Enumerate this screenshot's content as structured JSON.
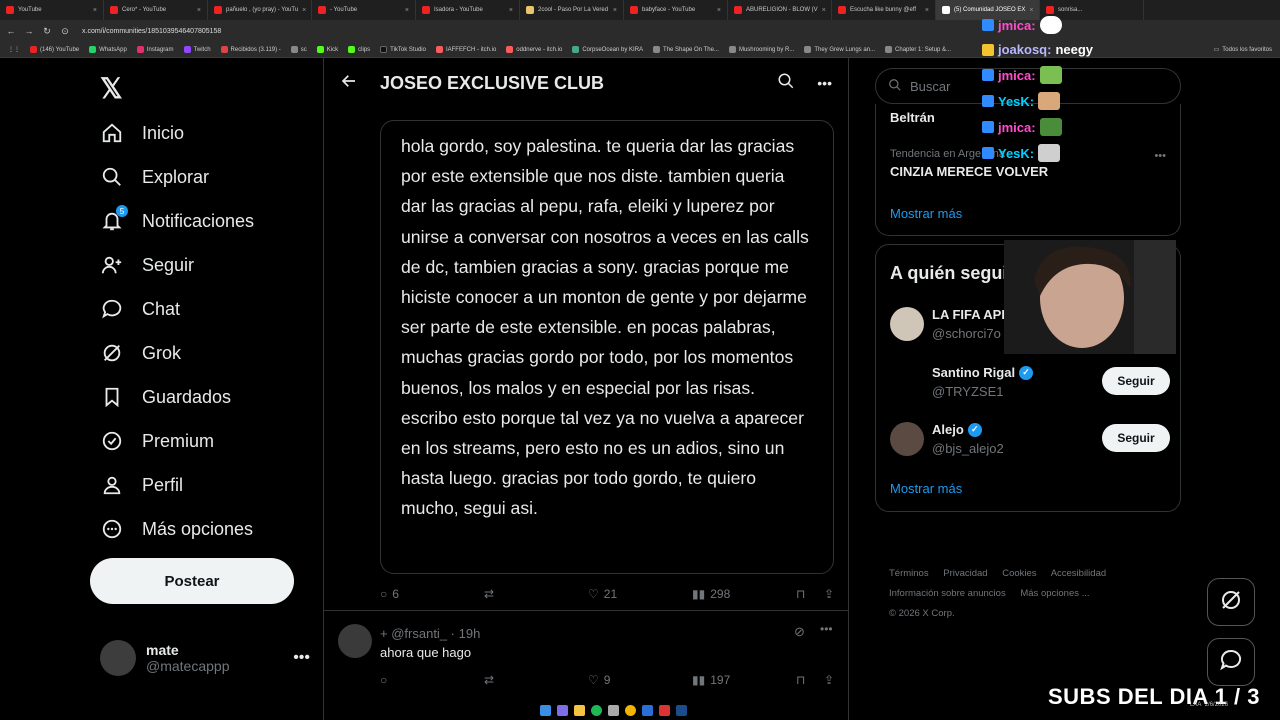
{
  "browser": {
    "tabs": [
      {
        "label": "YouTube",
        "active": false
      },
      {
        "label": "Cero* - YouTube",
        "active": false
      },
      {
        "label": "pañuelo , (yo pray) - YouTu",
        "active": false
      },
      {
        "label": "- YouTube",
        "active": false
      },
      {
        "label": "Isadora - YouTube",
        "active": false
      },
      {
        "label": "2cool - Paso Por La Vered",
        "active": false
      },
      {
        "label": "babyface - YouTube",
        "active": false
      },
      {
        "label": "ABURELIGION - BLOW (V",
        "active": false
      },
      {
        "label": "Escucha like bunny @eff",
        "active": false
      },
      {
        "label": "(5) Comunidad JOSEO EX",
        "active": true
      },
      {
        "label": "sonrisa...",
        "active": false
      }
    ],
    "url": "x.com/i/communities/1851039546407805158",
    "bookmarks": [
      "(146) YouTube",
      "WhatsApp",
      "Instagram",
      "Twitch",
      "Recibidos (3.119) -",
      "sc",
      "Kick",
      "clips",
      "TikTok Studio",
      "IAFFEFCH - itch.io",
      "oddnerve - itch.io",
      "CorpseOcean by KIRA",
      "The Shape On The...",
      "Mushrooming by R...",
      "They Grew Lungs an...",
      "Chapter 1: Setup &..."
    ],
    "bookmarks_right": "Todos los favoritos"
  },
  "nav": {
    "items": [
      {
        "label": "Inicio",
        "icon": "home-icon"
      },
      {
        "label": "Explorar",
        "icon": "search-icon"
      },
      {
        "label": "Notificaciones",
        "icon": "bell-icon",
        "badge": "5"
      },
      {
        "label": "Seguir",
        "icon": "add-person-icon"
      },
      {
        "label": "Chat",
        "icon": "chat-icon"
      },
      {
        "label": "Grok",
        "icon": "grok-icon"
      },
      {
        "label": "Guardados",
        "icon": "bookmark-icon"
      },
      {
        "label": "Premium",
        "icon": "premium-icon"
      },
      {
        "label": "Perfil",
        "icon": "person-icon"
      },
      {
        "label": "Más opciones",
        "icon": "more-circle-icon"
      }
    ],
    "post_label": "Postear",
    "account": {
      "name": "mate",
      "handle": "@matecappp"
    }
  },
  "main": {
    "title": "JOSEO EXCLUSIVE CLUB",
    "message": "hola gordo, soy palestina. te queria dar las gracias por este extensible que nos diste. tambien queria dar las gracias al pepu, rafa, eleiki y luperez por unirse a conversar con nosotros a veces en las calls de dc, tambien gracias a sony. gracias porque me hiciste conocer a un monton de gente y por dejarme ser parte de este extensible. en pocas palabras, muchas gracias gordo por todo, por los momentos buenos, los malos y en especial por las risas. escribo esto porque tal vez ya no vuelva a aparecer en los streams, pero esto no es un adios, sino un hasta luego. gracias por todo gordo, te quiero mucho, segui asi.",
    "post_stats": {
      "replies": "6",
      "likes": "21",
      "views": "298"
    },
    "reply": {
      "handle": "@frsanti_",
      "time": "19h",
      "text": "ahora que hago",
      "likes": "9",
      "views": "197"
    }
  },
  "right": {
    "search_placeholder": "Buscar",
    "trends": [
      {
        "context": "",
        "name": "Beltrán"
      },
      {
        "context": "Tendencia en Argentina",
        "name": "CINZIA MERECE VOLVER"
      }
    ],
    "trends_more": "Mostrar más",
    "follow_title": "A quién seguir",
    "suggestions": [
      {
        "name": "LA FIFA APRETO",
        "handle": "@schorci7o",
        "verified": false
      },
      {
        "name": "Santino Rigal",
        "handle": "@TRYZSE1",
        "verified": true
      },
      {
        "name": "Alejo",
        "handle": "@bjs_alejo2",
        "verified": true
      }
    ],
    "follow_label": "Seguir",
    "follow_more": "Mostrar más",
    "footer": [
      "Términos",
      "Privacidad",
      "Cookies",
      "Accesibilidad",
      "Información sobre anuncios",
      "Más opciones ...",
      "© 2026 X Corp."
    ]
  },
  "overlay": {
    "chat": [
      {
        "user": "jmica:",
        "msg": ""
      },
      {
        "user": "joakosq:",
        "msg": "neegy"
      },
      {
        "user": "jmica:",
        "msg": ""
      },
      {
        "user": "YesK:",
        "msg": ""
      },
      {
        "user": "jmica:",
        "msg": ""
      },
      {
        "user": "YesK:",
        "msg": ""
      }
    ],
    "subs": "SUBS DEL DIA 1 / 3",
    "tray_lang": "LAA",
    "tray_date": "2/6/2026"
  },
  "colors": {
    "accent": "#1d9bf0",
    "bg": "#000000",
    "border": "#2f3336",
    "muted": "#71767b"
  }
}
